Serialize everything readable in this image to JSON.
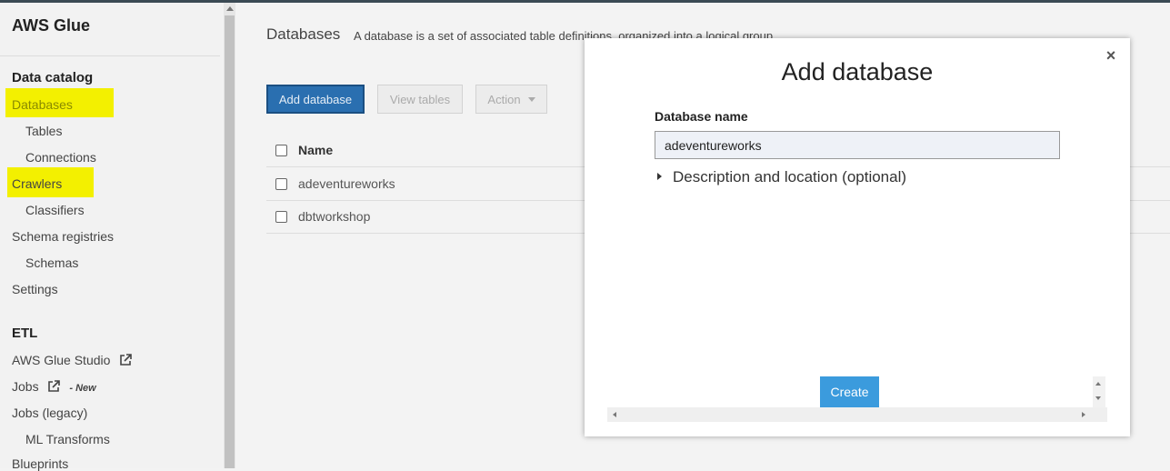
{
  "app": {
    "title": "AWS Glue"
  },
  "sidebar": {
    "sections": {
      "data_catalog": "Data catalog",
      "etl": "ETL"
    },
    "items": {
      "databases": "Databases",
      "tables": "Tables",
      "connections": "Connections",
      "crawlers": "Crawlers",
      "classifiers": "Classifiers",
      "schema_registries": "Schema registries",
      "schemas": "Schemas",
      "settings": "Settings",
      "glue_studio": "AWS Glue Studio",
      "jobs": "Jobs",
      "jobs_new_badge": "- New",
      "jobs_legacy": "Jobs (legacy)",
      "ml_transforms": "ML Transforms",
      "blueprints": "Blueprints"
    },
    "highlight_color": "#f3f000"
  },
  "main": {
    "title": "Databases",
    "description": "A database is a set of associated table definitions, organized into a logical group.",
    "buttons": {
      "add_database": "Add database",
      "view_tables": "View tables",
      "action": "Action"
    },
    "table": {
      "header": "Name",
      "rows": [
        "adeventureworks",
        "dbtworkshop"
      ]
    }
  },
  "modal": {
    "title": "Add database",
    "close": "×",
    "field_label": "Database name",
    "field_value": "adeventureworks",
    "expander": "Description and location (optional)",
    "create": "Create",
    "accent_color": "#3b9bdd"
  }
}
